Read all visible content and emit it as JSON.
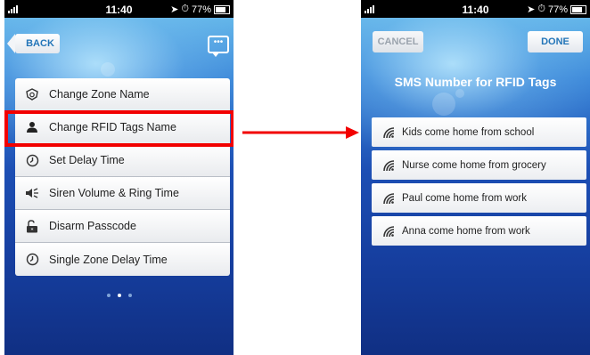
{
  "left_screen": {
    "status": {
      "time": "11:40",
      "battery": "77%"
    },
    "back_label": "BACK",
    "chat_label": "•••",
    "menu_items": [
      {
        "label": "Change Zone Name",
        "icon": "shield-icon"
      },
      {
        "label": "Change RFID Tags Name",
        "icon": "person-icon"
      },
      {
        "label": "Set Delay Time",
        "icon": "clock-icon"
      },
      {
        "label": "Siren Volume & Ring Time",
        "icon": "speaker-icon"
      },
      {
        "label": "Disarm Passcode",
        "icon": "unlock-icon"
      },
      {
        "label": "Single Zone Delay Time",
        "icon": "clock-icon"
      }
    ],
    "highlighted_item": "Change RFID Tags Name",
    "page_dots": 3,
    "active_dot": 2
  },
  "right_screen": {
    "status": {
      "time": "11:40",
      "battery": "77%"
    },
    "cancel_label": "CANCEL",
    "done_label": "DONE",
    "title": "SMS Number for RFID Tags",
    "tags": [
      {
        "label": "Kids come home from school",
        "icon": "rfid-signal-icon"
      },
      {
        "label": "Nurse come home from grocery",
        "icon": "rfid-signal-icon"
      },
      {
        "label": "Paul come home from work",
        "icon": "rfid-signal-icon"
      },
      {
        "label": "Anna come home from work",
        "icon": "rfid-signal-icon"
      }
    ]
  },
  "colors": {
    "highlight": "#f20000",
    "arrow": "#f20000",
    "accent_text": "#2375b8"
  }
}
